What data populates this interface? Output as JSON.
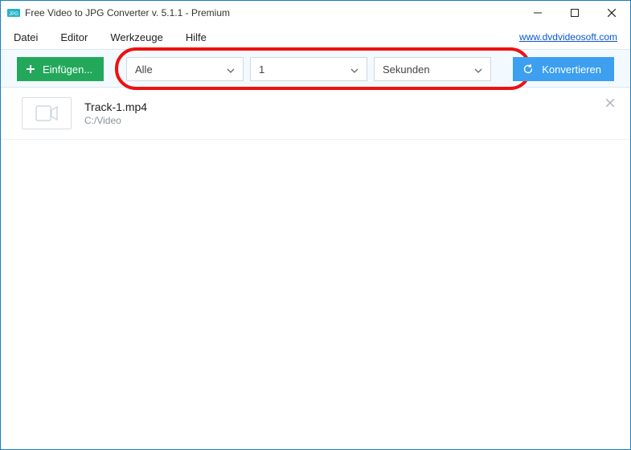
{
  "titlebar": {
    "title": "Free Video to JPG Converter v. 5.1.1 - Premium"
  },
  "menubar": {
    "items": [
      "Datei",
      "Editor",
      "Werkzeuge",
      "Hilfe"
    ],
    "link_label": "www.dvdvideosoft.com"
  },
  "toolbar": {
    "add_label": "Einfügen...",
    "convert_label": "Konvertieren",
    "dd_mode": "Alle",
    "dd_value": "1",
    "dd_unit": "Sekunden"
  },
  "files": [
    {
      "name": "Track-1.mp4",
      "path": "C:/Video"
    }
  ]
}
